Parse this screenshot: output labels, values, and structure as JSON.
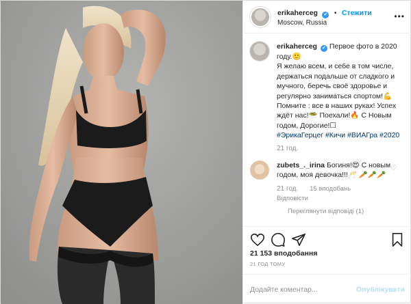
{
  "post": {
    "username": "erikaherceg",
    "verified_mark": "✔",
    "separator": "•",
    "follow_label": "Стежити",
    "location": "Moscow, Russia",
    "caption_username": "erikaherceg",
    "caption_line_1": "Первое фото в 2020 году.🙂",
    "caption_body": "Я желаю всем, и себе в том числе, держаться подальше от сладкого и мучного, беречь своё здоровье и регулярно заниматься спортом!💪 Помните : все в наших руках! Успех ждёт нас!🥗 Поехали!🔥 С Новым годом, Дорогие!☐",
    "caption_tags": "#ЭрикаГерцег #Кичи #ВИАГра #2020",
    "caption_time": "21 год."
  },
  "comment": {
    "username": "zubets_._irina",
    "text": "Богиня!😍 С новым годом, моя девочка!!!🥂 🥕🥕🥕",
    "time": "21 год.",
    "likes": "15 вподобань",
    "reply_label": "Відповісти",
    "view_replies": "Переглянути відповіді (1)"
  },
  "stats": {
    "likes": "21 153 вподобання",
    "time_ago": "21 ГОД ТОМУ"
  },
  "composer": {
    "placeholder": "Додайте коментар...",
    "post_label": "Опублікувати"
  },
  "icons": [
    "more-icon",
    "heart-icon",
    "comment-icon",
    "share-icon",
    "bookmark-icon",
    "small-heart-icon",
    "verified-icon"
  ],
  "colors": {
    "accent": "#0095f6",
    "verified": "#3897f0",
    "tag": "#00376b",
    "muted": "#8e8e8e",
    "post_disabled": "#b2dffc"
  }
}
